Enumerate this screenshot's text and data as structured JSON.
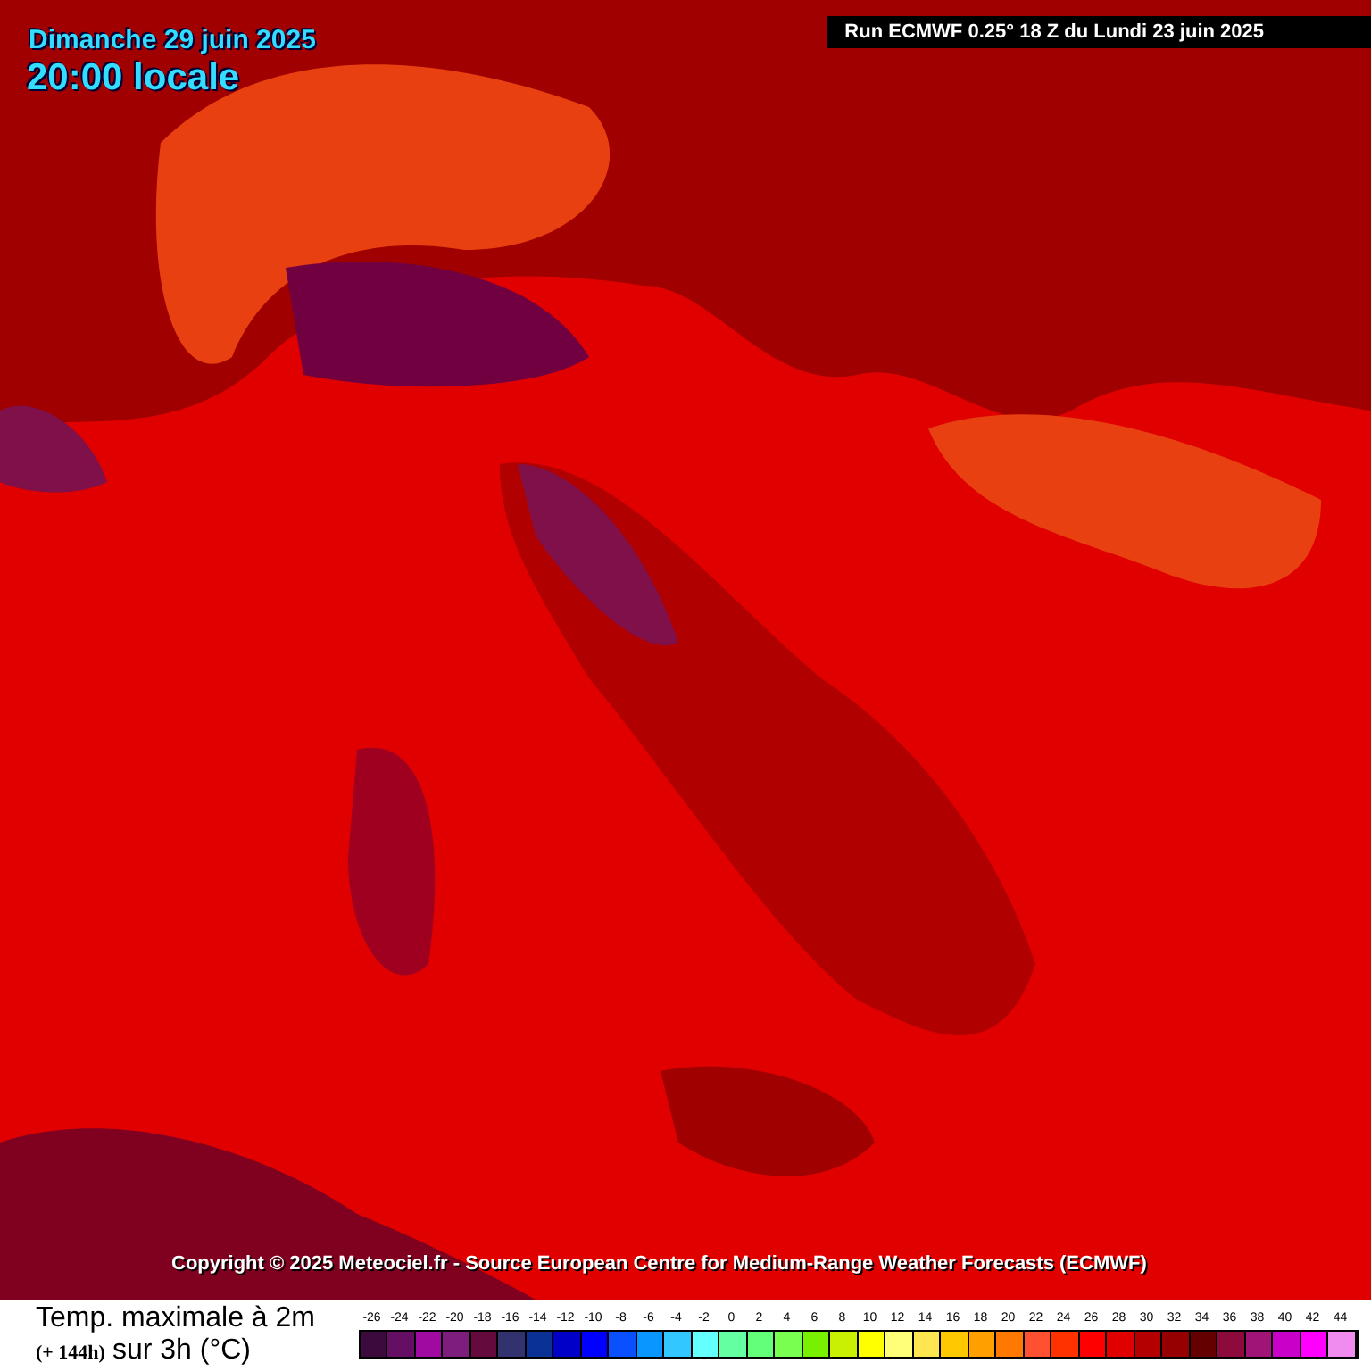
{
  "header": {
    "date": "Dimanche 29 juin 2025",
    "time": "20:00 locale",
    "run": "Run ECMWF 0.25° 18 Z du Lundi 23 juin 2025"
  },
  "copyright": "Copyright © 2025 Meteociel.fr - Source European Centre for Medium-Range Weather Forecasts (ECMWF)",
  "legend": {
    "title": "Temp. maximale à 2m",
    "lead": "(+ 144h)",
    "subtitle": "sur 3h (°C)",
    "scale": [
      {
        "label": "-26",
        "color": "#3c0a3c"
      },
      {
        "label": "-24",
        "color": "#640f64"
      },
      {
        "label": "-22",
        "color": "#a00aa0"
      },
      {
        "label": "-20",
        "color": "#7d1e7d"
      },
      {
        "label": "-18",
        "color": "#640a3c"
      },
      {
        "label": "-16",
        "color": "#32326e"
      },
      {
        "label": "-14",
        "color": "#0a3296"
      },
      {
        "label": "-12",
        "color": "#0000c8"
      },
      {
        "label": "-10",
        "color": "#0000ff"
      },
      {
        "label": "-8",
        "color": "#0a50ff"
      },
      {
        "label": "-6",
        "color": "#0a96ff"
      },
      {
        "label": "-4",
        "color": "#32c8ff"
      },
      {
        "label": "-2",
        "color": "#64ffff"
      },
      {
        "label": "0",
        "color": "#64ffa0"
      },
      {
        "label": "2",
        "color": "#64ff78"
      },
      {
        "label": "4",
        "color": "#78ff50"
      },
      {
        "label": "6",
        "color": "#78f000"
      },
      {
        "label": "8",
        "color": "#c8f000"
      },
      {
        "label": "10",
        "color": "#ffff00"
      },
      {
        "label": "12",
        "color": "#ffff78"
      },
      {
        "label": "14",
        "color": "#ffe650"
      },
      {
        "label": "16",
        "color": "#ffc800"
      },
      {
        "label": "18",
        "color": "#ffa000"
      },
      {
        "label": "20",
        "color": "#ff7800"
      },
      {
        "label": "22",
        "color": "#ff5032"
      },
      {
        "label": "24",
        "color": "#ff3200"
      },
      {
        "label": "26",
        "color": "#ff0000"
      },
      {
        "label": "28",
        "color": "#e10000"
      },
      {
        "label": "30",
        "color": "#b40000"
      },
      {
        "label": "32",
        "color": "#960000"
      },
      {
        "label": "34",
        "color": "#640000"
      },
      {
        "label": "36",
        "color": "#8c0a3c"
      },
      {
        "label": "38",
        "color": "#a01478"
      },
      {
        "label": "40",
        "color": "#c800c8"
      },
      {
        "label": "42",
        "color": "#ff00ff"
      },
      {
        "label": "44",
        "color": "#f08cf0"
      }
    ]
  }
}
